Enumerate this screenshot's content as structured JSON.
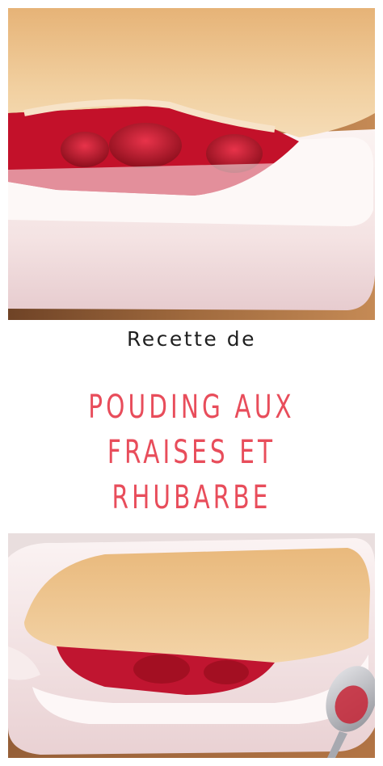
{
  "header": {
    "subtitle": "Recette de",
    "title_lines": [
      "POUDING AUX",
      "FRAISES ET",
      "RHUBARBE"
    ]
  },
  "colors": {
    "title": "#e84d5b",
    "subtitle": "#1f1f1f",
    "background": "#ffffff"
  },
  "images": [
    {
      "name": "dessert-photo-top",
      "description": "strawberry-rhubarb pudding cake in a white baking dish"
    },
    {
      "name": "dessert-photo-bottom",
      "description": "strawberry-rhubarb pudding cake in a white dish with a spoon"
    }
  ]
}
